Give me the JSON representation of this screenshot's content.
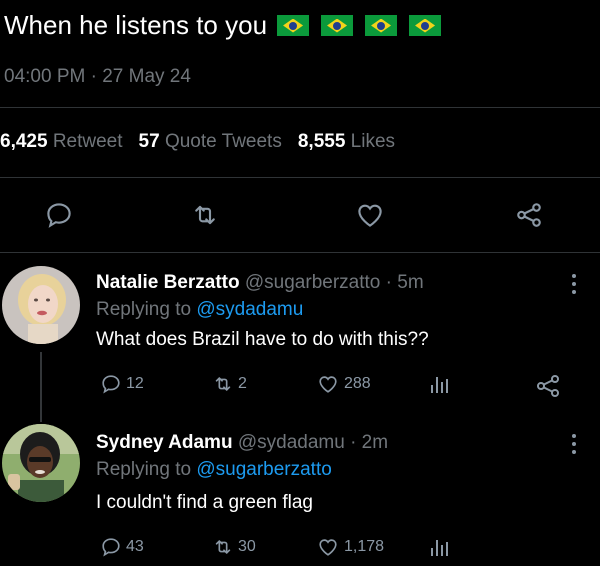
{
  "tweet": {
    "text": "When he listens to you",
    "flags": [
      "brazil-flag",
      "brazil-flag",
      "brazil-flag",
      "brazil-flag"
    ],
    "time": "04:00 PM",
    "sep": "·",
    "date": "27 May 24",
    "stats": {
      "retweets_num": "6,425",
      "retweets_label": "Retweet",
      "quotes_num": "57",
      "quotes_label": "Quote Tweets",
      "likes_num": "8,555",
      "likes_label": "Likes"
    }
  },
  "colors": {
    "accent": "#1d9bf0",
    "muted": "#71767b",
    "flag_green": "#0b9a3b",
    "flag_yellow": "#f2d31b",
    "flag_blue": "#1f3e8f"
  },
  "replies": [
    {
      "name": "Natalie Berzatto",
      "handle": "@sugarberzatto",
      "time": "· 5m",
      "replying_prefix": "Replying to",
      "replying_to": "@sydadamu",
      "text": "What does Brazil have to do with this??",
      "reply_count": "12",
      "retweet_count": "2",
      "like_count": "288"
    },
    {
      "name": "Sydney Adamu",
      "handle": "@sydadamu",
      "time": "· 2m",
      "replying_prefix": "Replying to",
      "replying_to": "@sugarberzatto",
      "text": "I couldn't find a green flag",
      "reply_count": "43",
      "retweet_count": "30",
      "like_count": "1,178"
    }
  ]
}
